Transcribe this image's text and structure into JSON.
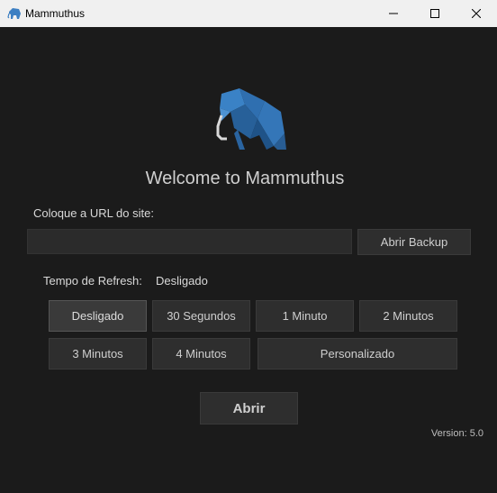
{
  "window": {
    "title": "Mammuthus",
    "icon": "elephant-icon",
    "controls": [
      "minimize-icon",
      "maximize-icon",
      "close-icon"
    ]
  },
  "main": {
    "logo_icon": "origami-elephant-logo",
    "welcome": "Welcome to Mammuthus",
    "url_label": "Coloque a URL do site:",
    "url_value": "",
    "url_placeholder": "",
    "backup_button": "Abrir Backup",
    "refresh_label": "Tempo de Refresh:",
    "refresh_value": "Desligado",
    "refresh_options": [
      {
        "label": "Desligado",
        "selected": true
      },
      {
        "label": "30 Segundos",
        "selected": false
      },
      {
        "label": "1 Minuto",
        "selected": false
      },
      {
        "label": "2 Minutos",
        "selected": false
      },
      {
        "label": "3 Minutos",
        "selected": false
      },
      {
        "label": "4 Minutos",
        "selected": false
      },
      {
        "label": "Personalizado",
        "selected": false
      }
    ],
    "open_button": "Abrir",
    "version": "Version: 5.0"
  },
  "colors": {
    "background": "#1b1b1b",
    "button": "#2e2e2e",
    "titlebar": "#f0f0f0",
    "logo_blue": "#2f6fb0",
    "text": "#cfcfcf"
  }
}
